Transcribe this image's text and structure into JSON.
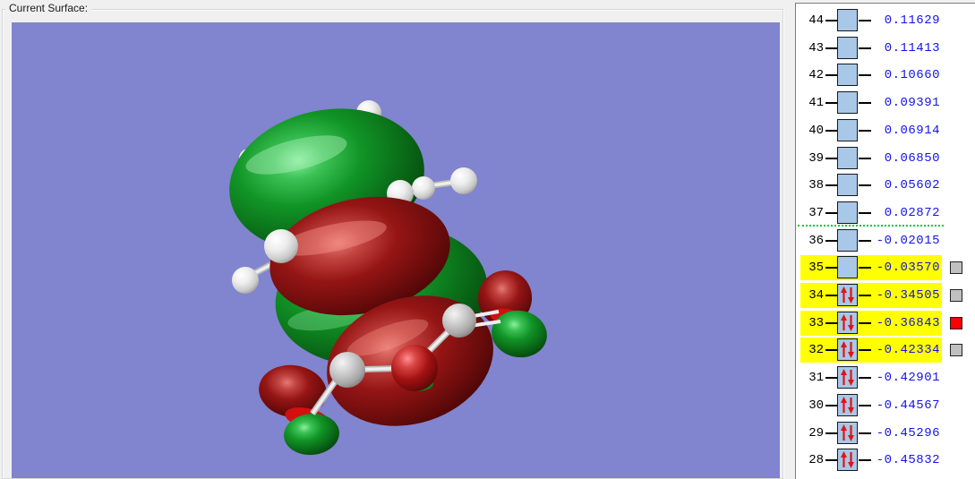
{
  "group_label": "Current Surface:",
  "colors": {
    "viewport_background": "#8184ce",
    "row_highlight": "#ffff00",
    "energy_text": "#1414e6",
    "orbital_number_text": "#000000",
    "level_box_fill": "#a9c7e7",
    "homo_lumo_separator": "#00c832",
    "electron_arrow": "#e01414",
    "indicator_gray": "#c0c0c0",
    "indicator_red": "#ff0000",
    "surface_positive_lobe": "#0f8c22",
    "surface_negative_lobe": "#8c1212"
  },
  "orbital_panel": {
    "separator_after_orbital": "37",
    "rows": [
      {
        "num": "44",
        "energy": "0.11629",
        "occupied": false,
        "highlighted": false,
        "indicator": null
      },
      {
        "num": "43",
        "energy": "0.11413",
        "occupied": false,
        "highlighted": false,
        "indicator": null
      },
      {
        "num": "42",
        "energy": "0.10660",
        "occupied": false,
        "highlighted": false,
        "indicator": null
      },
      {
        "num": "41",
        "energy": "0.09391",
        "occupied": false,
        "highlighted": false,
        "indicator": null
      },
      {
        "num": "40",
        "energy": "0.06914",
        "occupied": false,
        "highlighted": false,
        "indicator": null
      },
      {
        "num": "39",
        "energy": "0.06850",
        "occupied": false,
        "highlighted": false,
        "indicator": null
      },
      {
        "num": "38",
        "energy": "0.05602",
        "occupied": false,
        "highlighted": false,
        "indicator": null
      },
      {
        "num": "37",
        "energy": "0.02872",
        "occupied": false,
        "highlighted": false,
        "indicator": null
      },
      {
        "num": "36",
        "energy": "-0.02015",
        "occupied": false,
        "highlighted": false,
        "indicator": null
      },
      {
        "num": "35",
        "energy": "-0.03570",
        "occupied": false,
        "highlighted": true,
        "indicator": "gray"
      },
      {
        "num": "34",
        "energy": "-0.34505",
        "occupied": true,
        "highlighted": true,
        "indicator": "gray"
      },
      {
        "num": "33",
        "energy": "-0.36843",
        "occupied": true,
        "highlighted": true,
        "indicator": "red"
      },
      {
        "num": "32",
        "energy": "-0.42334",
        "occupied": true,
        "highlighted": true,
        "indicator": "gray"
      },
      {
        "num": "31",
        "energy": "-0.42901",
        "occupied": true,
        "highlighted": false,
        "indicator": null
      },
      {
        "num": "30",
        "energy": "-0.44567",
        "occupied": true,
        "highlighted": false,
        "indicator": null
      },
      {
        "num": "29",
        "energy": "-0.45296",
        "occupied": true,
        "highlighted": false,
        "indicator": null
      },
      {
        "num": "28",
        "energy": "-0.45832",
        "occupied": true,
        "highlighted": false,
        "indicator": null
      }
    ]
  }
}
